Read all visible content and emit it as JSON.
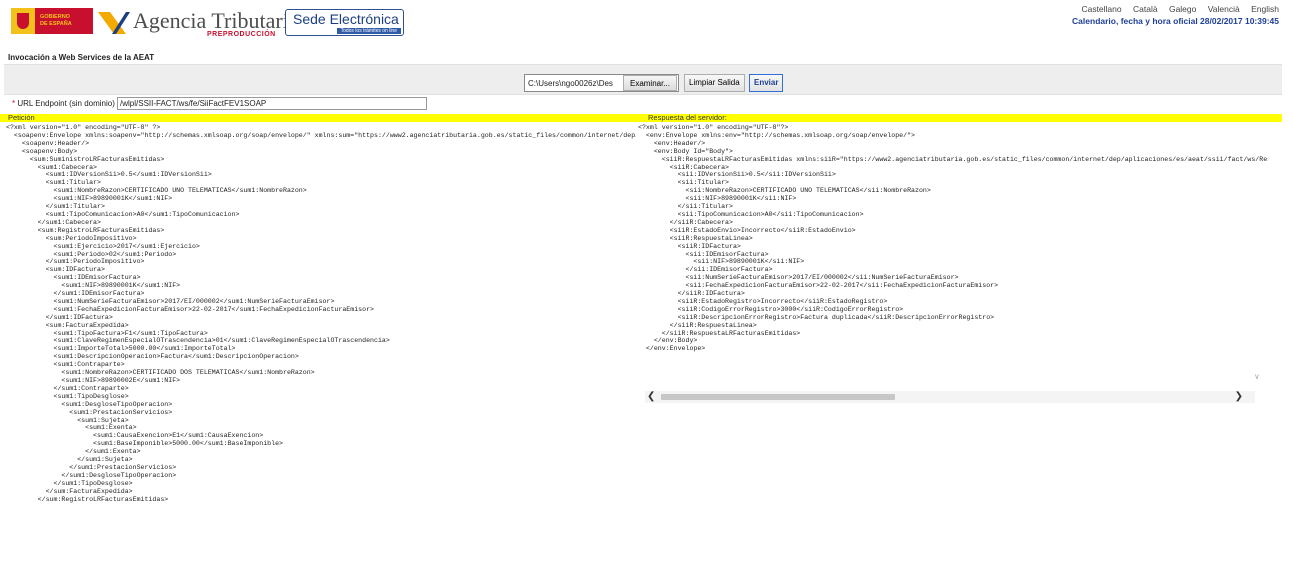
{
  "header": {
    "gov_logo_text": "GOBIERNO\nDE ESPAÑA",
    "agency_title": "Agencia Tributaria",
    "agency_subtitle": "PREPRODUCCIÓN",
    "sede_title": "Sede Electrónica",
    "sede_subtitle": "Todos los trámites on line",
    "languages": [
      "Castellano",
      "Català",
      "Galego",
      "Valencià",
      "English"
    ],
    "datetime": "Calendario, fecha y hora oficial 28/02/2017 10:39:45"
  },
  "page": {
    "section_title": "Invocación a Web Services de la AEAT"
  },
  "toolbar": {
    "file_path": "C:\\Users\\ngo0026z\\Des",
    "browse_label": "Examinar...",
    "clear_label": "Limpiar Salida",
    "send_label": "Enviar"
  },
  "endpoint": {
    "label": "URL Endpoint (sin dominio)",
    "value": "/wlpl/SSII-FACT/ws/fe/SiiFactFEV1SOAP"
  },
  "request": {
    "label": "Petición",
    "lines": [
      "<?xml version=\"1.0\" encoding=\"UTF-8\" ?>",
      "  <soapenv:Envelope xmlns:soapenv=\"http://schemas.xmlsoap.org/soap/envelope/\" xmlns:sum=\"https://www2.agenciatributaria.gob.es/static_files/common/internet/dep/aplicaciones/es/aeat/ssii/fact/ws/SuministroLR.xsd\"",
      "    <soapenv:Header/>",
      "    <soapenv:Body>",
      "      <sum:SuministroLRFacturasEmitidas>",
      "        <sum1:Cabecera>",
      "          <sum1:IDVersionSii>0.5</sum1:IDVersionSii>",
      "          <sum1:Titular>",
      "            <sum1:NombreRazon>CERTIFICADO UNO TELEMATICAS</sum1:NombreRazon>",
      "            <sum1:NIF>89890001K</sum1:NIF>",
      "          </sum1:Titular>",
      "          <sum1:TipoComunicacion>A0</sum1:TipoComunicacion>",
      "        </sum1:Cabecera>",
      "        <sum:RegistroLRFacturasEmitidas>",
      "          <sum:PeriodoImpositivo>",
      "            <sum1:Ejercicio>2017</sum1:Ejercicio>",
      "            <sum1:Periodo>02</sum1:Periodo>",
      "          </sum1:PeriodoImpositivo>",
      "          <sum:IDFactura>",
      "            <sum1:IDEmisorFactura>",
      "              <sum1:NIF>89890001K</sum1:NIF>",
      "            </sum1:IDEmisorFactura>",
      "            <sum1:NumSerieFacturaEmisor>2017/EI/000002</sum1:NumSerieFacturaEmisor>",
      "            <sum1:FechaExpedicionFacturaEmisor>22-02-2017</sum1:FechaExpedicionFacturaEmisor>",
      "          </sum1:IDFactura>",
      "          <sum:FacturaExpedida>",
      "            <sum1:TipoFactura>F1</sum1:TipoFactura>",
      "            <sum1:ClaveRegimenEspecialOTrascendencia>01</sum1:ClaveRegimenEspecialOTrascendencia>",
      "            <sum1:ImporteTotal>5000.00</sum1:ImporteTotal>",
      "            <sum1:DescripcionOperacion>Factura</sum1:DescripcionOperacion>",
      "            <sum1:Contraparte>",
      "              <sum1:NombreRazon>CERTIFICADO DOS TELEMATICAS</sum1:NombreRazon>",
      "              <sum1:NIF>89890002E</sum1:NIF>",
      "            </sum1:Contraparte>",
      "            <sum1:TipoDesglose>",
      "              <sum1:DesgloseTipoOperacion>",
      "                <sum1:PrestacionServicios>",
      "                  <sum1:Sujeta>",
      "                    <sum1:Exenta>",
      "                      <sum1:CausaExencion>E1</sum1:CausaExencion>",
      "                      <sum1:BaseImponible>5000.00</sum1:BaseImponible>",
      "                    </sum1:Exenta>",
      "                  </sum1:Sujeta>",
      "                </sum1:PrestacionServicios>",
      "              </sum1:DesgloseTipoOperacion>",
      "            </sum1:TipoDesglose>",
      "          </sum:FacturaExpedida>",
      "        </sum:RegistroLRFacturasEmitidas>"
    ]
  },
  "response": {
    "label": "Respuesta del servidor:",
    "lines": [
      "<?xml version=\"1.0\" encoding=\"UTF-8\"?>",
      "  <env:Envelope xmlns:env=\"http://schemas.xmlsoap.org/soap/envelope/\">",
      "    <env:Header/>",
      "    <env:Body Id=\"Body\">",
      "      <siiR:RespuestaLRFacturasEmitidas xmlns:siiR=\"https://www2.agenciatributaria.gob.es/static_files/common/internet/dep/aplicaciones/es/aeat/ssii/fact/ws/RespuestaSuministro.xsd\">",
      "        <siiR:Cabecera>",
      "          <sii:IDVersionSii>0.5</sii:IDVersionSii>",
      "          <sii:Titular>",
      "            <sii:NombreRazon>CERTIFICADO UNO TELEMATICAS</sii:NombreRazon>",
      "            <sii:NIF>89890001K</sii:NIF>",
      "          </sii:Titular>",
      "          <sii:TipoComunicacion>A0</sii:TipoComunicacion>",
      "        </siiR:Cabecera>",
      "        <siiR:EstadoEnvio>Incorrecto</siiR:EstadoEnvio>",
      "        <siiR:RespuestaLinea>",
      "          <siiR:IDFactura>",
      "            <sii:IDEmisorFactura>",
      "              <sii:NIF>89890001K</sii:NIF>",
      "            </sii:IDEmisorFactura>",
      "            <sii:NumSerieFacturaEmisor>2017/EI/000002</sii:NumSerieFacturaEmisor>",
      "            <sii:FechaExpedicionFacturaEmisor>22-02-2017</sii:FechaExpedicionFacturaEmisor>",
      "          </siiR:IDFactura>",
      "          <siiR:EstadoRegistro>Incorrecto</siiR:EstadoRegistro>",
      "          <siiR:CodigoErrorRegistro>3000</siiR:CodigoErrorRegistro>",
      "          <siiR:DescripcionErrorRegistro>Factura duplicada</siiR:DescripcionErrorRegistro>",
      "        </siiR:RespuestaLinea>",
      "      </siiR:RespuestaLRFacturasEmitidas>",
      "    </env:Body>",
      "  </env:Envelope>"
    ]
  },
  "colors": {
    "highlight_bar": "#ffff00",
    "link_blue": "#1f3f99",
    "brand_red": "#c8102e"
  }
}
